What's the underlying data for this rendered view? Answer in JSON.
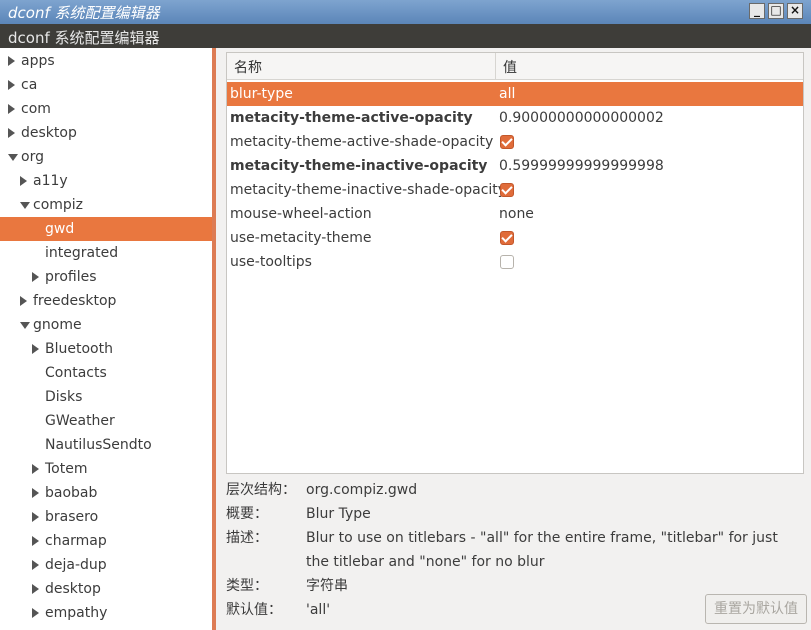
{
  "window": {
    "title": "dconf 系统配置编辑器",
    "header_title": "dconf 系统配置编辑器",
    "controls": [
      "_",
      "□",
      "×"
    ]
  },
  "tree": [
    {
      "label": "apps",
      "level": 0,
      "state": "collapsed"
    },
    {
      "label": "ca",
      "level": 0,
      "state": "collapsed"
    },
    {
      "label": "com",
      "level": 0,
      "state": "collapsed"
    },
    {
      "label": "desktop",
      "level": 0,
      "state": "collapsed"
    },
    {
      "label": "org",
      "level": 0,
      "state": "expanded"
    },
    {
      "label": "a11y",
      "level": 1,
      "state": "collapsed"
    },
    {
      "label": "compiz",
      "level": 1,
      "state": "expanded"
    },
    {
      "label": "gwd",
      "level": 2,
      "state": "leaf",
      "selected": true
    },
    {
      "label": "integrated",
      "level": 2,
      "state": "leaf"
    },
    {
      "label": "profiles",
      "level": 2,
      "state": "collapsed"
    },
    {
      "label": "freedesktop",
      "level": 1,
      "state": "collapsed"
    },
    {
      "label": "gnome",
      "level": 1,
      "state": "expanded"
    },
    {
      "label": "Bluetooth",
      "level": 2,
      "state": "collapsed"
    },
    {
      "label": "Contacts",
      "level": 2,
      "state": "leaf"
    },
    {
      "label": "Disks",
      "level": 2,
      "state": "leaf"
    },
    {
      "label": "GWeather",
      "level": 2,
      "state": "leaf"
    },
    {
      "label": "NautilusSendto",
      "level": 2,
      "state": "leaf"
    },
    {
      "label": "Totem",
      "level": 2,
      "state": "collapsed"
    },
    {
      "label": "baobab",
      "level": 2,
      "state": "collapsed"
    },
    {
      "label": "brasero",
      "level": 2,
      "state": "collapsed"
    },
    {
      "label": "charmap",
      "level": 2,
      "state": "collapsed"
    },
    {
      "label": "deja-dup",
      "level": 2,
      "state": "collapsed"
    },
    {
      "label": "desktop",
      "level": 2,
      "state": "collapsed"
    },
    {
      "label": "empathy",
      "level": 2,
      "state": "collapsed"
    }
  ],
  "table": {
    "headers": {
      "name": "名称",
      "value": "值"
    },
    "rows": [
      {
        "name": "blur-type",
        "type": "text",
        "value": "all",
        "bold": false,
        "selected": true
      },
      {
        "name": "metacity-theme-active-opacity",
        "type": "text",
        "value": "0.90000000000000002",
        "bold": true
      },
      {
        "name": "metacity-theme-active-shade-opacity",
        "type": "check",
        "checked": true,
        "bold": false
      },
      {
        "name": "metacity-theme-inactive-opacity",
        "type": "text",
        "value": "0.59999999999999998",
        "bold": true
      },
      {
        "name": "metacity-theme-inactive-shade-opacity",
        "type": "check",
        "checked": true,
        "bold": false
      },
      {
        "name": "mouse-wheel-action",
        "type": "text",
        "value": "none",
        "bold": false
      },
      {
        "name": "use-metacity-theme",
        "type": "check",
        "checked": true,
        "bold": false
      },
      {
        "name": "use-tooltips",
        "type": "check",
        "checked": false,
        "bold": false
      }
    ]
  },
  "details": {
    "schema_label": "层次结构：",
    "schema_value": "org.compiz.gwd",
    "summary_label": "概要：",
    "summary_value": "Blur Type",
    "description_label": "描述：",
    "description_value": "Blur to use on titlebars - \"all\" for the entire frame, \"titlebar\" for just the titlebar and \"none\" for no blur",
    "type_label": "类型：",
    "type_value": "字符串",
    "default_label": "默认值：",
    "default_value": "'all'"
  },
  "buttons": {
    "reset": "重置为默认值"
  },
  "colors": {
    "accent": "#e9773f",
    "header_bg": "#3e3d39"
  }
}
